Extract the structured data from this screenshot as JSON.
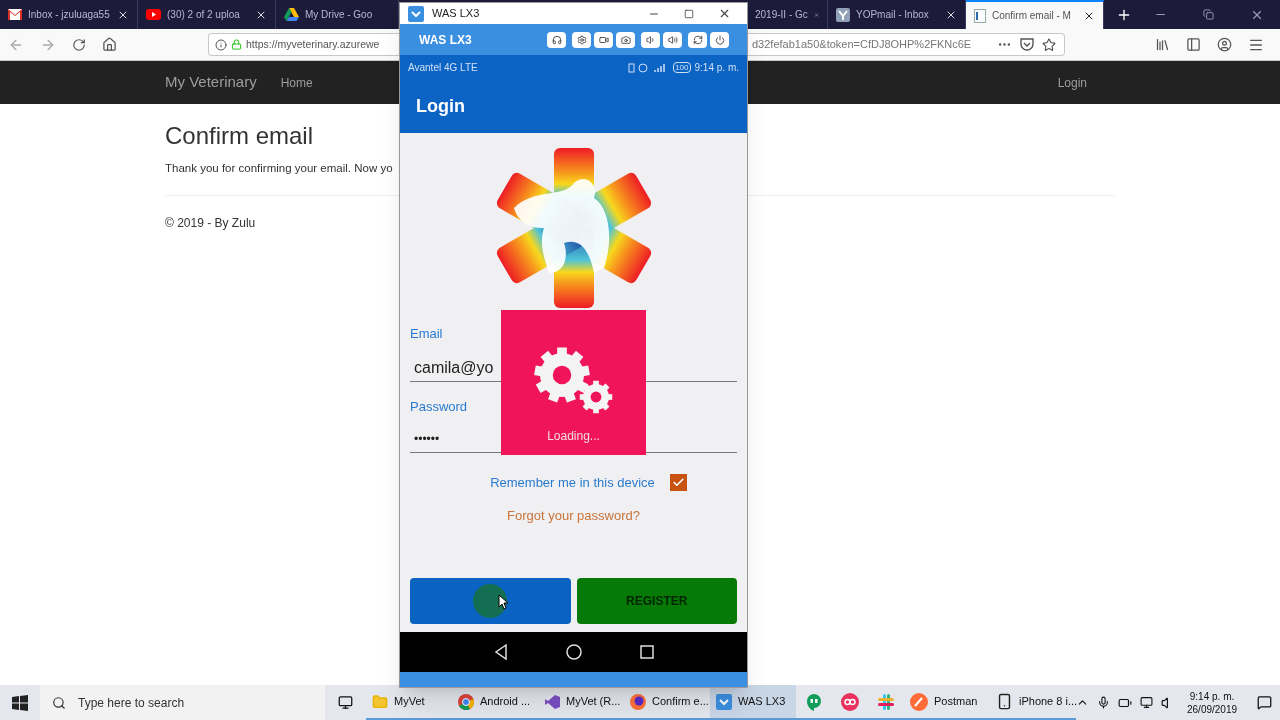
{
  "browser": {
    "tabs": [
      {
        "title": "Inbox - jzuluaga55",
        "kind": "mail",
        "selected": false
      },
      {
        "title": "(30) 2 of 2 uploa",
        "kind": "video",
        "selected": false
      },
      {
        "title": "My Drive - Goo",
        "kind": "drive",
        "selected": false
      },
      {
        "title": "2019-II - Gc",
        "kind": "hidden",
        "selected": false
      },
      {
        "title": "YOPmail - Inbox",
        "kind": "yop",
        "selected": false
      },
      {
        "title": "Confirm email - M",
        "kind": "page",
        "selected": true
      }
    ],
    "url_start": "https://myveterinary.azurewe",
    "url_end": "d32fefab1a50&token=CfDJ8OHP%2FKNc6E"
  },
  "site": {
    "brand": "My Veterinary",
    "nav": [
      "Home"
    ],
    "login": "Login",
    "heading": "Confirm email",
    "message": "Thank you for confirming your email. Now yo",
    "footer": "© 2019 - By Zulu"
  },
  "emulator": {
    "window_title": "WAS LX3",
    "device": "WAS LX3",
    "carrier": "Avantel 4G LTE",
    "battery": "100",
    "time": "9:14 p. m.",
    "screen_title": "Login",
    "email_label": "Email",
    "email_value": "camila@yo",
    "password_label": "Password",
    "password_value": "••••••",
    "remember": {
      "label": "Remember me in this device",
      "checked": true
    },
    "forgot": "Forgot your password?",
    "loading": "Loading...",
    "register": "REGISTER"
  },
  "taskbar": {
    "search_placeholder": "Type here to search",
    "apps": [
      {
        "label": "MyVet",
        "kind": "folder",
        "selected": false
      },
      {
        "label": "Android ...",
        "kind": "chrome",
        "selected": false
      },
      {
        "label": "MyVet (R...",
        "kind": "vs",
        "selected": false
      },
      {
        "label": "Confirm e...",
        "kind": "firefox",
        "selected": false
      },
      {
        "label": "WAS LX3",
        "kind": "emulator",
        "selected": true
      },
      {
        "kind": "hangouts",
        "selected": false
      },
      {
        "kind": "oo",
        "selected": false
      },
      {
        "kind": "slack",
        "selected": false
      },
      {
        "label": "Postman",
        "kind": "postman",
        "selected": false
      },
      {
        "label": "iPhone 8 i...",
        "kind": "phone",
        "selected": false
      }
    ],
    "time": "9:14 p. m.",
    "date": "26/09/2019"
  }
}
